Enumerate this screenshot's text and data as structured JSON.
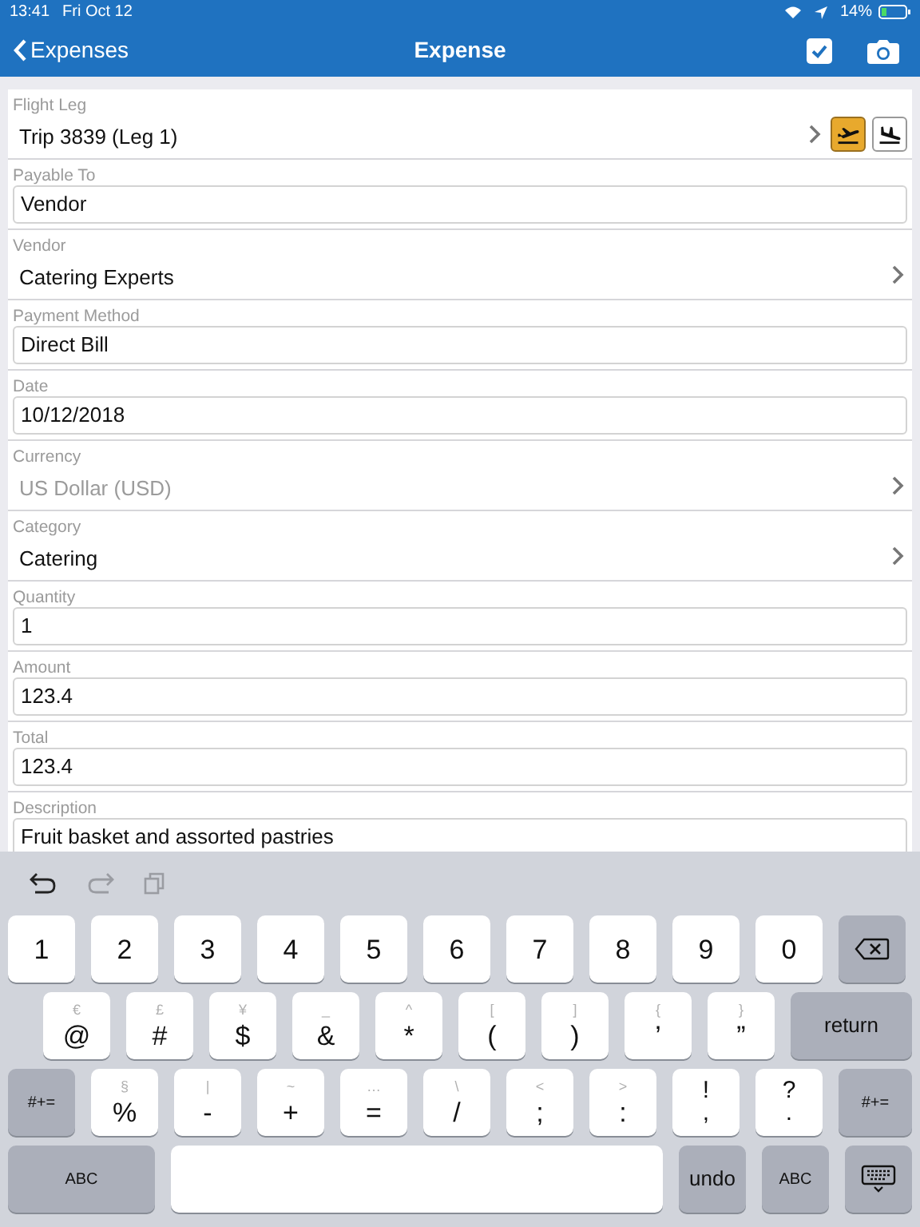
{
  "status_bar": {
    "time": "13:41",
    "date": "Fri Oct 12",
    "battery": "14%"
  },
  "nav": {
    "back": "Expenses",
    "title": "Expense"
  },
  "form": [
    {
      "kind": "flight",
      "label": "Flight Leg",
      "value": "Trip 3839 (Leg 1)",
      "modes": [
        {
          "kind": "takeoff",
          "selected": true
        },
        {
          "kind": "landing",
          "selected": false
        }
      ]
    },
    {
      "kind": "field",
      "label": "Payable To",
      "value": "Vendor"
    },
    {
      "kind": "picker",
      "label": "Vendor",
      "value": "Catering Experts",
      "disabled": false
    },
    {
      "kind": "field",
      "label": "Payment Method",
      "value": "Direct Bill"
    },
    {
      "kind": "field",
      "label": "Date",
      "value": "10/12/2018"
    },
    {
      "kind": "picker",
      "label": "Currency",
      "value": "US Dollar (USD)",
      "disabled": true
    },
    {
      "kind": "picker",
      "label": "Category",
      "value": "Catering",
      "disabled": false
    },
    {
      "kind": "field",
      "label": "Quantity",
      "value": "1"
    },
    {
      "kind": "field",
      "label": "Amount",
      "value": "123.4"
    },
    {
      "kind": "field",
      "label": "Total",
      "value": "123.4"
    },
    {
      "kind": "field",
      "label": "Description",
      "value": "Fruit basket and assorted pastries"
    }
  ],
  "keyboard": {
    "number_row": [
      {
        "kind": "key",
        "label": "1"
      },
      {
        "kind": "key",
        "label": "2"
      },
      {
        "kind": "key",
        "label": "3"
      },
      {
        "kind": "key",
        "label": "4"
      },
      {
        "kind": "key",
        "label": "5"
      },
      {
        "kind": "key",
        "label": "6"
      },
      {
        "kind": "key",
        "label": "7"
      },
      {
        "kind": "key",
        "label": "8"
      },
      {
        "kind": "key",
        "label": "9"
      },
      {
        "kind": "key",
        "label": "0"
      },
      {
        "kind": "delete"
      }
    ],
    "symbol_row": [
      {
        "kind": "key",
        "label": "@",
        "hint": "€"
      },
      {
        "kind": "key",
        "label": "#",
        "hint": "£"
      },
      {
        "kind": "key",
        "label": "$",
        "hint": "¥"
      },
      {
        "kind": "key",
        "label": "&",
        "hint": "_"
      },
      {
        "kind": "key",
        "label": "*",
        "hint": "^"
      },
      {
        "kind": "key",
        "label": "(",
        "hint": "["
      },
      {
        "kind": "key",
        "label": ")",
        "hint": "]"
      },
      {
        "kind": "key",
        "label": "’",
        "hint": "{"
      },
      {
        "kind": "key",
        "label": "”",
        "hint": "}"
      },
      {
        "kind": "action",
        "label": "return"
      }
    ],
    "punctuation_row": [
      {
        "kind": "action",
        "label": "#+="
      },
      {
        "kind": "key",
        "label": "%",
        "hint": "§"
      },
      {
        "kind": "key",
        "label": "-",
        "hint": "|"
      },
      {
        "kind": "key",
        "label": "+",
        "hint": "~"
      },
      {
        "kind": "key",
        "label": "=",
        "hint": "…"
      },
      {
        "kind": "key",
        "label": "/",
        "hint": "\\"
      },
      {
        "kind": "key",
        "label": ";",
        "hint": "<"
      },
      {
        "kind": "key",
        "label": ":",
        "hint": ">"
      },
      {
        "kind": "dual",
        "label": ",",
        "upper": "!"
      },
      {
        "kind": "dual",
        "label": ".",
        "upper": "?"
      },
      {
        "kind": "action",
        "label": "#+="
      }
    ],
    "bottom_row": [
      {
        "kind": "action",
        "label": "ABC"
      },
      {
        "kind": "space"
      },
      {
        "kind": "action",
        "label": "undo"
      },
      {
        "kind": "action",
        "label": "ABC"
      },
      {
        "kind": "dismiss"
      }
    ]
  }
}
